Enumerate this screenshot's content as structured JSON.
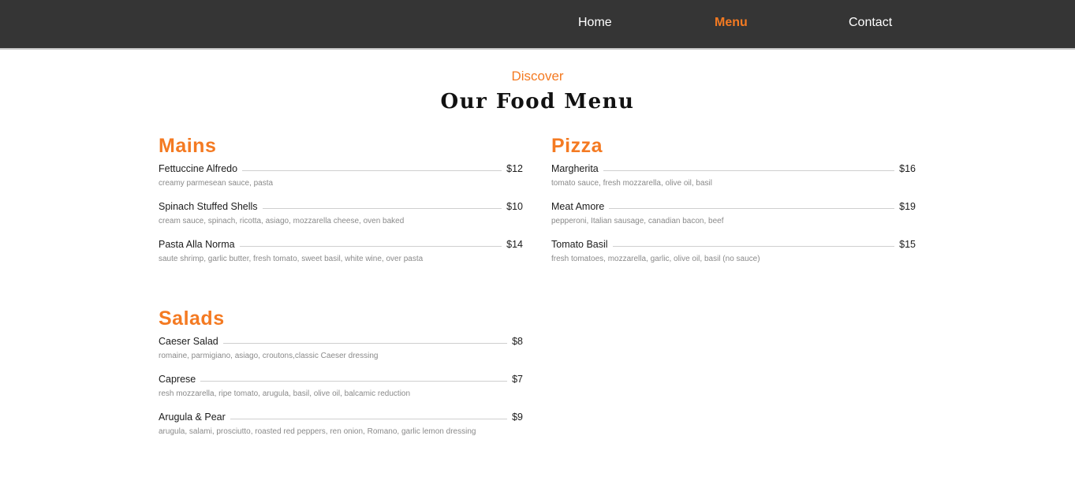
{
  "nav": {
    "links": [
      {
        "label": "Home",
        "active": false
      },
      {
        "label": "Menu",
        "active": true
      },
      {
        "label": "Contact",
        "active": false
      }
    ]
  },
  "header": {
    "eyebrow": "Discover",
    "title": "Our Food Menu"
  },
  "colors": {
    "accent": "#f47a22",
    "nav_background": "#353535"
  },
  "sections": [
    {
      "title": "Mains",
      "items": [
        {
          "name": "Fettuccine Alfredo",
          "price": "$12",
          "description": "creamy parmesean sauce, pasta"
        },
        {
          "name": "Spinach Stuffed Shells",
          "price": "$10",
          "description": "cream sauce, spinach, ricotta, asiago, mozzarella cheese, oven baked"
        },
        {
          "name": "Pasta Alla Norma",
          "price": "$14",
          "description": "saute shrimp, garlic butter, fresh tomato, sweet basil, white wine, over pasta"
        }
      ]
    },
    {
      "title": "Pizza",
      "items": [
        {
          "name": "Margherita",
          "price": "$16",
          "description": "tomato sauce, fresh mozzarella, olive oil, basil"
        },
        {
          "name": "Meat Amore",
          "price": "$19",
          "description": "pepperoni, Italian sausage, canadian bacon, beef"
        },
        {
          "name": "Tomato Basil",
          "price": "$15",
          "description": "fresh tomatoes, mozzarella, garlic, olive oil, basil (no sauce)"
        }
      ]
    },
    {
      "title": "Salads",
      "items": [
        {
          "name": "Caeser Salad",
          "price": "$8",
          "description": "romaine, parmigiano, asiago, croutons,classic Caeser dressing"
        },
        {
          "name": "Caprese",
          "price": "$7",
          "description": "resh mozzarella, ripe tomato, arugula, basil, olive oil, balcamic reduction"
        },
        {
          "name": "Arugula & Pear",
          "price": "$9",
          "description": "arugula, salami, prosciutto, roasted red peppers, ren onion, Romano, garlic lemon dressing"
        }
      ]
    }
  ]
}
